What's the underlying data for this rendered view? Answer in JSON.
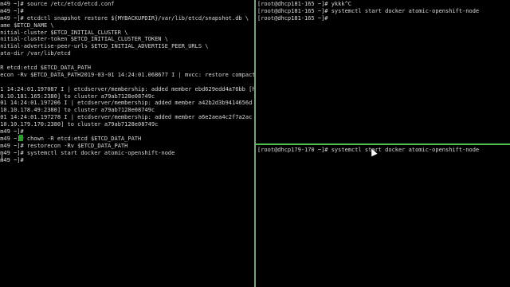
{
  "left_pane": {
    "lines": [
      "vm49 ~]# source /etc/etcd/etcd.conf",
      "vm49 ~]#",
      "vm49 ~]# etcdctl snapshot restore ${MYBACKUPDIR}/var/lib/etcd/snapshot.db \\",
      "name $ETCD_NAME \\",
      "initial-cluster $ETCD_INITIAL_CLUSTER \\",
      "initial-cluster-token $ETCD_INITIAL_CLUSTER_TOKEN \\",
      "initial-advertise-peer-urls $ETCD_INITIAL_ADVERTISE_PEER_URLS \\",
      "data-dir /var/lib/etcd",
      "",
      "-R etcd:etcd $ETCD_DATA_PATH",
      "recon -Rv $ETCD_DATA_PATH2019-03-01 14:24:01.068677 I | mvcc: restore compact to",
      "",
      "01 14:24:01.197087 I | etcdserver/membership: added member ebd629edd4a76bb [ht",
      "10.10.181.165:2380] to cluster a79ab7128e08749c",
      "-01 14:24:01.197206 I | etcdserver/membership: added member a42b2d3b9414656d [h",
      "/10.10.178.49:2380] to cluster a79ab7128e08749c",
      "-01 14:24:01.197278 I | etcdserver/membership: added member a6e2aea4c2f7a2ac [h",
      "/10.10.179.170:2380] to cluster a79ab7128e08749c",
      "vm49 ~]#",
      "vm49 ~]# chown -R etcd:etcd $ETCD_DATA_PATH",
      "vm49 ~]# restorecon -Rv $ETCD_DATA_PATH",
      "vm49 ~]# systemctl start docker atomic-openshift-node",
      "vm49 ~]#"
    ]
  },
  "right_top_pane": {
    "lines": [
      "[root@dhcp181-165 ~]# ykkk^C",
      "[root@dhcp181-165 ~]# systemctl start docker atomic-openshift-node",
      "[root@dhcp181-165 ~]#"
    ]
  },
  "right_bottom_pane": {
    "lines": [
      "[root@dhcp179-170 ~]# systemctl start docker atomic-openshift-node"
    ]
  },
  "colors": {
    "background": "#000000",
    "text": "#d8d8d8",
    "active_pane_border": "#4fbf4f",
    "cursor": "#2a9d2a"
  }
}
